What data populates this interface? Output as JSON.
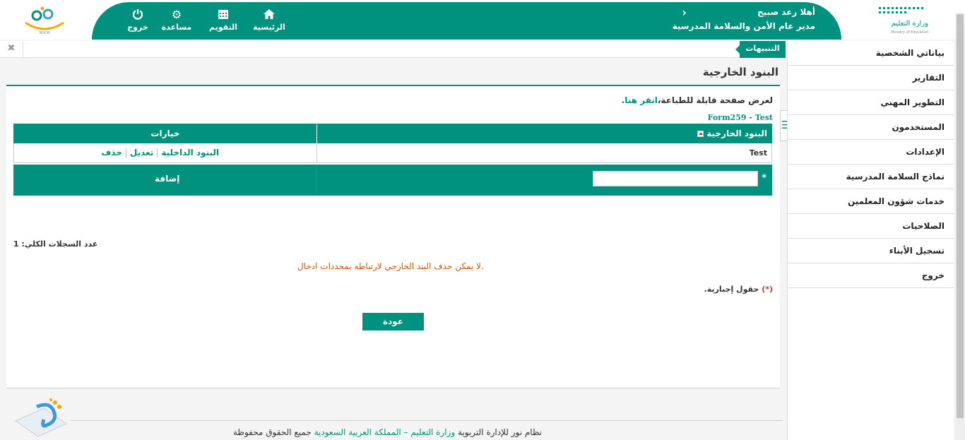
{
  "header": {
    "greeting": "أهلا رعد صبيح",
    "role": "مدير عام الأمن والسلامة المدرسية",
    "nav": [
      {
        "label": "الرئيسية",
        "icon": "home-icon"
      },
      {
        "label": "التقويم",
        "icon": "calendar-icon"
      },
      {
        "label": "مساعدة",
        "icon": "gear-icon"
      },
      {
        "label": "خروج",
        "icon": "power-icon"
      }
    ],
    "ministry_logo_text": "وزارة التعليم",
    "ministry_logo_sub": "Ministry of Education",
    "noor_logo_text": "NOOR"
  },
  "alerts": {
    "tab_label": "التنبيهات",
    "close_glyph": "✖"
  },
  "page": {
    "title": "البنود الخارجية",
    "print_text": "لعرض صفحة قابلة للطباعة،",
    "print_link": "انقر هنا.",
    "form_id": "Form259 - Test"
  },
  "grid": {
    "col_name": "البنود الخارجية",
    "col_options": "خيارات",
    "rows": [
      {
        "name": "Test",
        "link_inner": "البنود الداخلية",
        "link_edit": "تعديل",
        "link_delete": "حذف"
      }
    ],
    "add_required": "*",
    "add_label": "إضافة",
    "add_value": ""
  },
  "total_label": "عدد السجلات الكلي: 1",
  "warning": "لا يمكن حذف البند الخارجي لارتباطه بمحددات ادخال.",
  "required_note_star": "(*)",
  "required_note_text": "حقول إجبارية.",
  "back_label": "عودة",
  "sidebar": {
    "items": [
      "بياناتي الشخصية",
      "التقارير",
      "التطوير المهني",
      "المستخدمون",
      "الإعدادات",
      "نماذج السلامة المدرسية",
      "خدمات شؤون المعلمين",
      "الصلاحيات",
      "تسجيل الأبناء",
      "خروج"
    ]
  },
  "footer": {
    "part1": "نظام نور للإدارة التربوية",
    "part2": "وزارة التعليم – المملكة العربية السعودية",
    "part3": "جميع الحقوق محفوظة"
  },
  "colors": {
    "brand": "#00927e",
    "warning": "#d35400"
  }
}
